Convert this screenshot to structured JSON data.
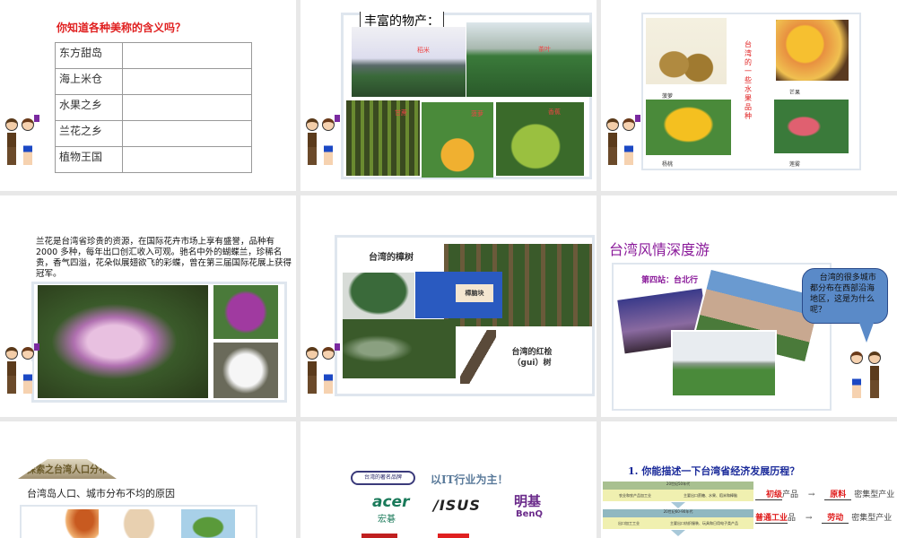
{
  "slide1": {
    "title": "你知道各种美称的含义吗？",
    "rows": [
      "东方甜岛",
      "海上米仓",
      "水果之乡",
      "兰花之乡",
      "植物王国"
    ]
  },
  "slide2": {
    "title": "丰富的物产：",
    "labels": [
      "稻米",
      "茶叶",
      "甘蔗",
      "菠萝",
      "香蕉"
    ]
  },
  "slide3": {
    "vertical_title": "台湾的一些水果品种",
    "fruits": [
      "菠萝",
      "芒果",
      "杨桃",
      "莲雾"
    ]
  },
  "slide4": {
    "text": "兰花是台湾省珍贵的资源，在国际花卉市场上享有盛誉，品种有 2000 多种，每年出口创汇收入可观。驰名中外的蝴蝶兰，珍稀名贵，香气四溢，花朵似展翅欲飞的彩蝶，曾在第三届国际花展上获得冠军。"
  },
  "slide5": {
    "title": "台湾的樟树",
    "product": "樟脑块",
    "caption": "台湾的红桧（gui）树"
  },
  "slide6": {
    "title": "台湾风情深度游",
    "stop": "第四站：台北行",
    "bubble": "台湾的很多城市都分布在西部沿海地区，这是为什么呢？"
  },
  "slide7": {
    "wordart": "探索之台湾人口分布",
    "subtitle": "台湾岛人口、城市分布不均的原因"
  },
  "slide8": {
    "badge": "台湾的著名品牌",
    "headline": "以IT行业为主！",
    "brands": [
      {
        "logo": "acer",
        "cn": "宏碁"
      },
      {
        "logo": "/ISUS",
        "cn": ""
      },
      {
        "logo": "BenQ",
        "cn": "明基"
      }
    ]
  },
  "slide9": {
    "question": "1. 你能描述一下台湾省经济发展历程？",
    "stages": [
      {
        "era": "20世纪50年代",
        "left": "农业和农产品加工业",
        "right": "主要出口蔗糖、水果、稻米和樟脑"
      },
      {
        "era": "20世纪60-90年代",
        "left": "出口加工工业",
        "right": "主要出口纺织服装、玩具和日用电子类产品"
      }
    ],
    "answers": [
      {
        "a": "初级",
        "mid": "产品",
        "arrow": "→",
        "b": "原料",
        "tail": "密集型产业"
      },
      {
        "a": "普通工业",
        "mid": "品",
        "arrow": "→",
        "b": "劳动",
        "tail": "密集型产业"
      }
    ]
  },
  "colors": {
    "accent_red": "#e02020",
    "purple": "#8a1a9a",
    "blue_title": "#1a2a9a"
  }
}
